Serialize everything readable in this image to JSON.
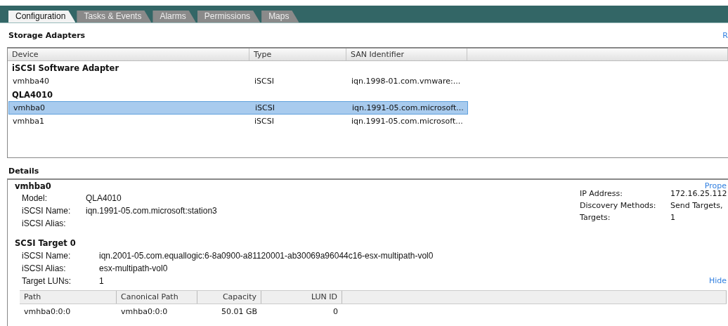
{
  "tabs": [
    {
      "label": "Configuration",
      "selected": true
    },
    {
      "label": "Tasks & Events",
      "selected": false
    },
    {
      "label": "Alarms",
      "selected": false
    },
    {
      "label": "Permissions",
      "selected": false
    },
    {
      "label": "Maps",
      "selected": false
    }
  ],
  "storage_adapters": {
    "title": "Storage Adapters",
    "link": "R",
    "columns": [
      "Device",
      "Type",
      "SAN Identifier"
    ],
    "rows": [
      {
        "kind": "group",
        "device": "iSCSI Software Adapter"
      },
      {
        "kind": "item",
        "device": "vmhba40",
        "type": "iSCSI",
        "san": "iqn.1998-01.com.vmware:...",
        "selected": false
      },
      {
        "kind": "group",
        "device": "QLA4010"
      },
      {
        "kind": "item",
        "device": "vmhba0",
        "type": "iSCSI",
        "san": "iqn.1991-05.com.microsoft...",
        "selected": true
      },
      {
        "kind": "item",
        "device": "vmhba1",
        "type": "iSCSI",
        "san": "iqn.1991-05.com.microsoft...",
        "selected": false
      }
    ]
  },
  "details": {
    "title": "Details",
    "adapter": "vmhba0",
    "link": "Prope",
    "fields": [
      {
        "label": "Model:",
        "value": "QLA4010"
      },
      {
        "label": "iSCSI Name:",
        "value": "iqn.1991-05.com.microsoft:station3"
      },
      {
        "label": "iSCSI Alias:"
      }
    ],
    "side_fields": [
      {
        "label": "IP Address:",
        "value": "172.16.25.112"
      },
      {
        "label": "Discovery Methods:",
        "value": "Send Targets,"
      },
      {
        "label": "Targets:",
        "value": "1"
      }
    ],
    "target": {
      "title": "SCSI Target 0",
      "hide_link": "Hide",
      "fields": [
        {
          "label": "iSCSI Name:",
          "value": "iqn.2001-05.com.equallogic:6-8a0900-a81120001-ab30069a96044c16-esx-multipath-vol0"
        },
        {
          "label": "iSCSI Alias:",
          "value": "esx-multipath-vol0"
        },
        {
          "label": "Target LUNs:",
          "value": "1"
        }
      ],
      "columns": [
        "Path",
        "Canonical Path",
        "Capacity",
        "LUN ID"
      ],
      "rows": [
        [
          "vmhba0:0:0",
          "vmhba0:0:0",
          "50.01 GB",
          "0"
        ]
      ]
    }
  }
}
